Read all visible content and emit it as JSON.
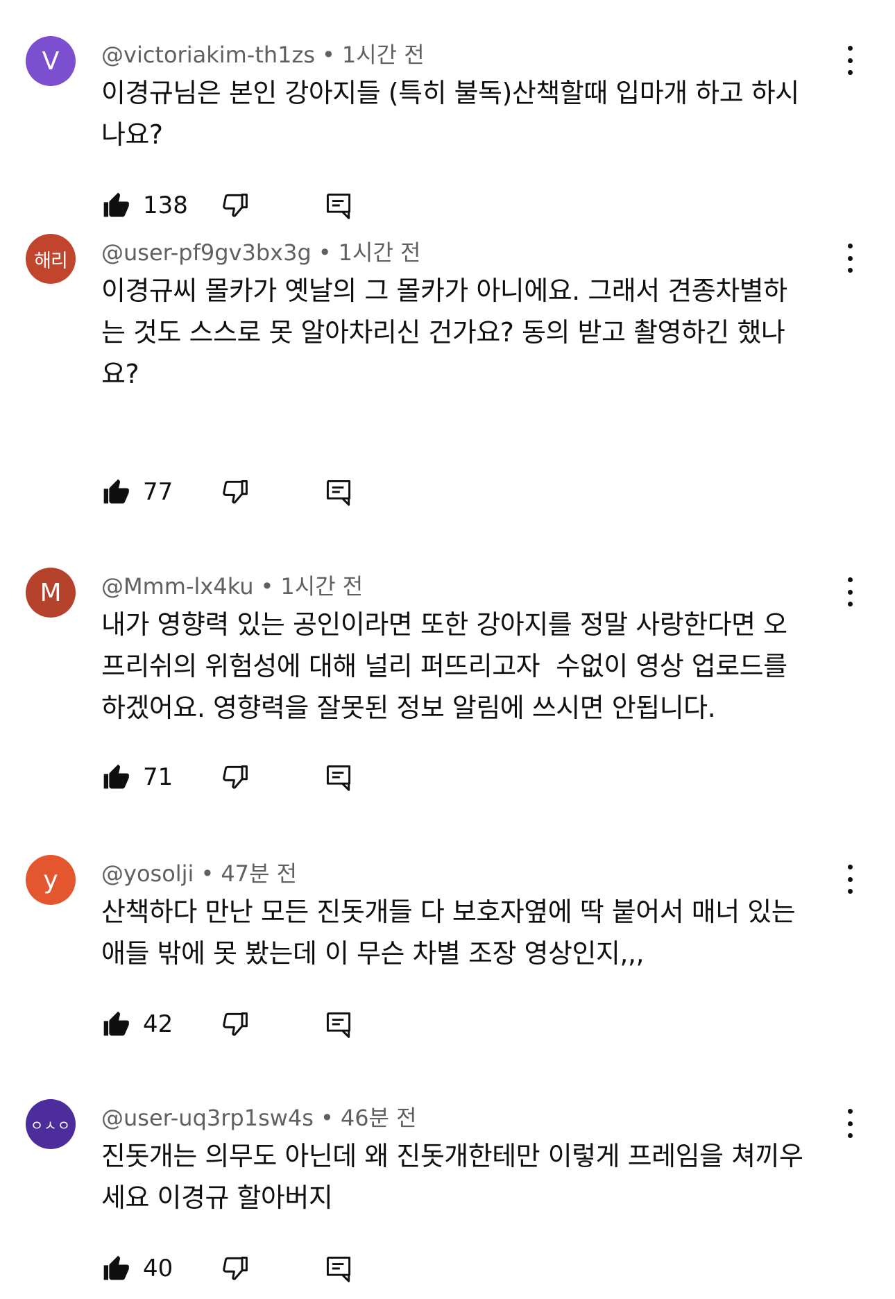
{
  "comments": [
    {
      "avatar_text": "V",
      "avatar_color": "#7b4fcf",
      "handle": "@victoriakim-th1zs",
      "time": "1시간 전",
      "text": "이경규님은 본인 강아지들 (특히 불독)산책할때 입마개 하고 하시\n나요?",
      "likes": "138"
    },
    {
      "avatar_text": "해리",
      "avatar_color": "#c1442c",
      "handle": "@user-pf9gv3bx3g",
      "time": "1시간 전",
      "text": "이경규씨 몰카가 옛날의 그 몰카가 아니에요. 그래서 견종차별하\n는 것도 스스로 못 알아차리신 건가요? 동의 받고 촬영하긴 했나\n요?",
      "likes": "77"
    },
    {
      "avatar_text": "M",
      "avatar_color": "#b5422a",
      "handle": "@Mmm-lx4ku",
      "time": "1시간 전",
      "text": "내가 영향력 있는 공인이라면 또한 강아지를 정말 사랑한다면 오\n프리쉬의 위험성에 대해 널리 퍼뜨리고자  수없이 영상 업로드를\n하겠어요. 영향력을 잘못된 정보 알림에 쓰시면 안됩니다.",
      "likes": "71"
    },
    {
      "avatar_text": "y",
      "avatar_color": "#e4572e",
      "handle": "@yosolji",
      "time": "47분 전",
      "text": "산책하다 만난 모든 진돗개들 다 보호자옆에 딱 붙어서 매너 있는\n애들 밖에 못 봤는데 이 무슨 차별 조장 영상인지,,,",
      "likes": "42"
    },
    {
      "avatar_text": "ㅇㅅㅇ",
      "avatar_color": "#4d2c9c",
      "handle": "@user-uq3rp1sw4s",
      "time": "46분 전",
      "text": "진돗개는 의무도 아닌데 왜 진돗개한테만 이렇게 프레임을 쳐끼우\n세요 이경규 할아버지",
      "likes": "40"
    }
  ],
  "icons": {
    "like": "thumb-up-icon",
    "dislike": "thumb-down-icon",
    "reply": "reply-icon",
    "more": "more-vert-icon"
  }
}
